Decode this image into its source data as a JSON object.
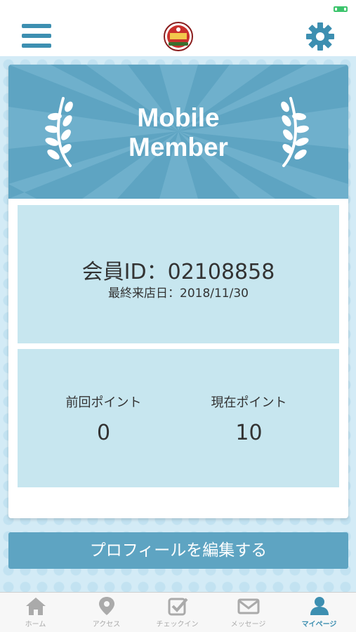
{
  "colors": {
    "accent": "#3d8fb1",
    "banner": "#5ea4c2",
    "panel": "#c7e6ef",
    "tab_inactive": "#aaaaaa"
  },
  "header": {
    "menu_icon": "hamburger-menu-icon",
    "logo": "shop-logo",
    "settings_icon": "gear-icon"
  },
  "card": {
    "banner_title_line1": "Mobile",
    "banner_title_line2": "Member",
    "member_id_label": "会員ID：02108858",
    "last_visit_label": "最終来店日：2018/11/30",
    "points": {
      "previous_label": "前回ポイント",
      "previous_value": "0",
      "current_label": "現在ポイント",
      "current_value": "10"
    }
  },
  "edit_profile_label": "プロフィールを編集する",
  "tabs": [
    {
      "label": "ホーム",
      "icon": "home-icon",
      "active": false
    },
    {
      "label": "アクセス",
      "icon": "map-pin-icon",
      "active": false
    },
    {
      "label": "チェックイン",
      "icon": "checkbox-icon",
      "active": false
    },
    {
      "label": "メッセージ",
      "icon": "envelope-icon",
      "active": false
    },
    {
      "label": "マイページ",
      "icon": "user-icon",
      "active": true
    }
  ]
}
